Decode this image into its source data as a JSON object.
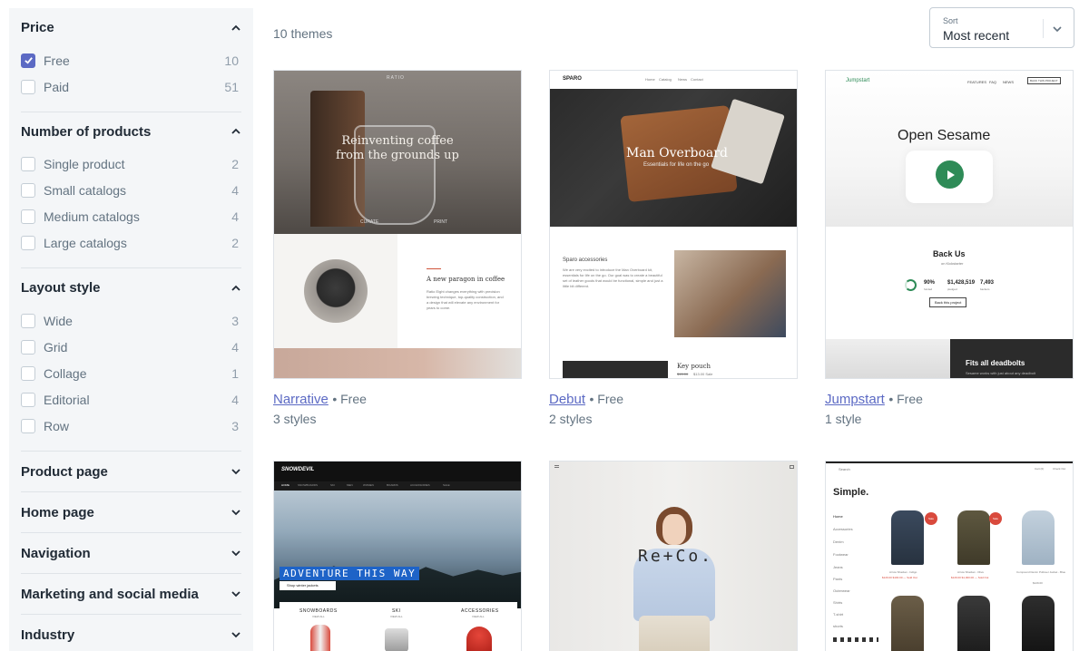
{
  "sidebar": {
    "price": {
      "title": "Price",
      "options": [
        {
          "label": "Free",
          "count": "10",
          "checked": true
        },
        {
          "label": "Paid",
          "count": "51",
          "checked": false
        }
      ]
    },
    "products": {
      "title": "Number of products",
      "options": [
        {
          "label": "Single product",
          "count": "2"
        },
        {
          "label": "Small catalogs",
          "count": "4"
        },
        {
          "label": "Medium catalogs",
          "count": "4"
        },
        {
          "label": "Large catalogs",
          "count": "2"
        }
      ]
    },
    "layout": {
      "title": "Layout style",
      "options": [
        {
          "label": "Wide",
          "count": "3"
        },
        {
          "label": "Grid",
          "count": "4"
        },
        {
          "label": "Collage",
          "count": "1"
        },
        {
          "label": "Editorial",
          "count": "4"
        },
        {
          "label": "Row",
          "count": "3"
        }
      ]
    },
    "collapsed": [
      "Product page",
      "Home page",
      "Navigation",
      "Marketing and social media",
      "Industry"
    ]
  },
  "main": {
    "count_text": "10 themes",
    "sort": {
      "label": "Sort",
      "value": "Most recent"
    }
  },
  "themes": [
    {
      "name": "Narrative",
      "price": "Free",
      "styles": "3 styles",
      "preview": {
        "logo": "RATIO",
        "headline": "Reinventing coffee from the grounds up",
        "nav_a": "CURATE",
        "nav_b": "PRINT",
        "subhead": "A new paragon in coffee",
        "body": "Ratio Eight changes everything with precision brewing technique, top-quality construction, and a design that will elevate any environment for years to come."
      }
    },
    {
      "name": "Debut",
      "price": "Free",
      "styles": "2 styles",
      "preview": {
        "logo": "SPARO",
        "nav": [
          "Home",
          "Catalog",
          "News",
          "Contact"
        ],
        "headline": "Man Overboard",
        "subline": "Essentials for life on the go",
        "section": "Sparo accessories",
        "body": "We are very excited to introduce the Man Overboard kit, essentials for life on the go. Our goal was to create a beautiful set of leather goods that would be functional, simple and just a little bit different.",
        "product": "Key pouch",
        "old_price": "$15.00",
        "new_price": "$13.00 Sale"
      }
    },
    {
      "name": "Jumpstart",
      "price": "Free",
      "styles": "1 style",
      "preview": {
        "logo": "Jumpstart",
        "nav": [
          "FEATURES",
          "FAQ",
          "NEWS"
        ],
        "nav_button": "BACK THIS PROJECT",
        "headline": "Open Sesame",
        "back_title": "Back Us",
        "back_sub": "on Kickstarter",
        "stats": [
          {
            "value": "90%",
            "label": "funded"
          },
          {
            "value": "$1,428,519",
            "label": "pledged"
          },
          {
            "value": "7,493",
            "label": "backers"
          }
        ],
        "button": "Back this project",
        "promo": "Fits all deadbolts",
        "promo_sub": "Sesame works with just about any deadbolt"
      }
    },
    {
      "name": "",
      "price": "",
      "styles": "",
      "preview": {
        "logo": "SNOWDEVIL",
        "nav": [
          "HOME",
          "SNOWBOARDS",
          "SKI",
          "MEN",
          "WOMEN",
          "BOARDS",
          "ACCESSORIES",
          "SALE"
        ],
        "banner": "ADVENTURE THIS WAY",
        "cta": "Shop winter jackets",
        "categories": [
          {
            "title": "SNOWBOARDS",
            "link": "VIEW ALL"
          },
          {
            "title": "SKI",
            "link": "VIEW ALL"
          },
          {
            "title": "ACCESSORIES",
            "link": "VIEW ALL"
          }
        ]
      }
    },
    {
      "name": "",
      "price": "",
      "styles": "",
      "preview": {
        "logo": "Re+Co."
      }
    },
    {
      "name": "",
      "price": "",
      "styles": "",
      "preview": {
        "search": "Search",
        "cart": "Cart (0)",
        "checkout": "Check Out",
        "logo": "Simple.",
        "menu": [
          "Home",
          "Accessories",
          "Denim",
          "Footwear",
          "Jeans",
          "Pants",
          "Outerwear",
          "Shirts",
          "T-shirt",
          "shorts"
        ],
        "products": [
          {
            "name": "Arrow Shacket - Indigo",
            "price": "$129.00 $100.00 — Sold Out",
            "badge": "Sale"
          },
          {
            "name": "Arrow Shacket - Olive",
            "price": "$129.00 $1,000.00 — Sold Out",
            "badge": "Sale"
          },
          {
            "name": "Compound Denim Pullover Jacket - Blue",
            "price": "$129.00",
            "badge": ""
          }
        ]
      }
    }
  ],
  "colors": {
    "accent": "#5c6ac4",
    "sidebar_bg": "#f4f6f8",
    "text": "#212b36",
    "muted": "#637381",
    "jumpstart_green": "#2e8b57",
    "snowdevil_blue": "#1e63c7",
    "sale_red": "#d94a3d"
  },
  "icons": {
    "expanded": "chevron-up-icon",
    "collapsed": "chevron-down-icon",
    "check": "check-icon",
    "play": "play-icon"
  }
}
